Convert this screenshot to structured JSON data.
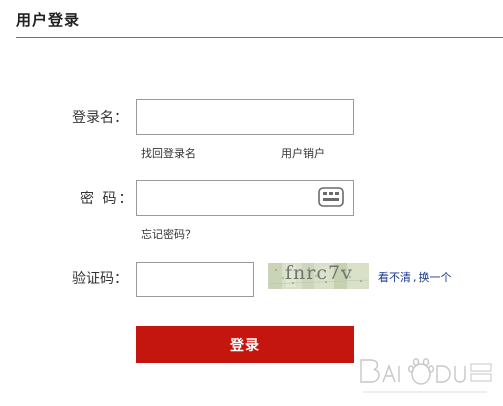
{
  "header": {
    "title": "用户登录"
  },
  "form": {
    "username_label": "登录名：",
    "password_label": "密 码：",
    "captcha_label": "验证码：",
    "username_value": "",
    "password_value": "",
    "captcha_value": "",
    "keyboard_icon": "keyboard-icon"
  },
  "links": {
    "find_username": "找回登录名",
    "cancel_user": "用户销户",
    "forgot_password": "忘记密码？"
  },
  "captcha": {
    "image_text": "fnrc7v",
    "cant_see": "看不清",
    "separator": ",",
    "change_one": "换一个"
  },
  "login_button": {
    "label": "登录"
  },
  "colors": {
    "accent": "#c4160e",
    "link_blue": "#1a3a8c",
    "rule": "#8a6a52"
  }
}
